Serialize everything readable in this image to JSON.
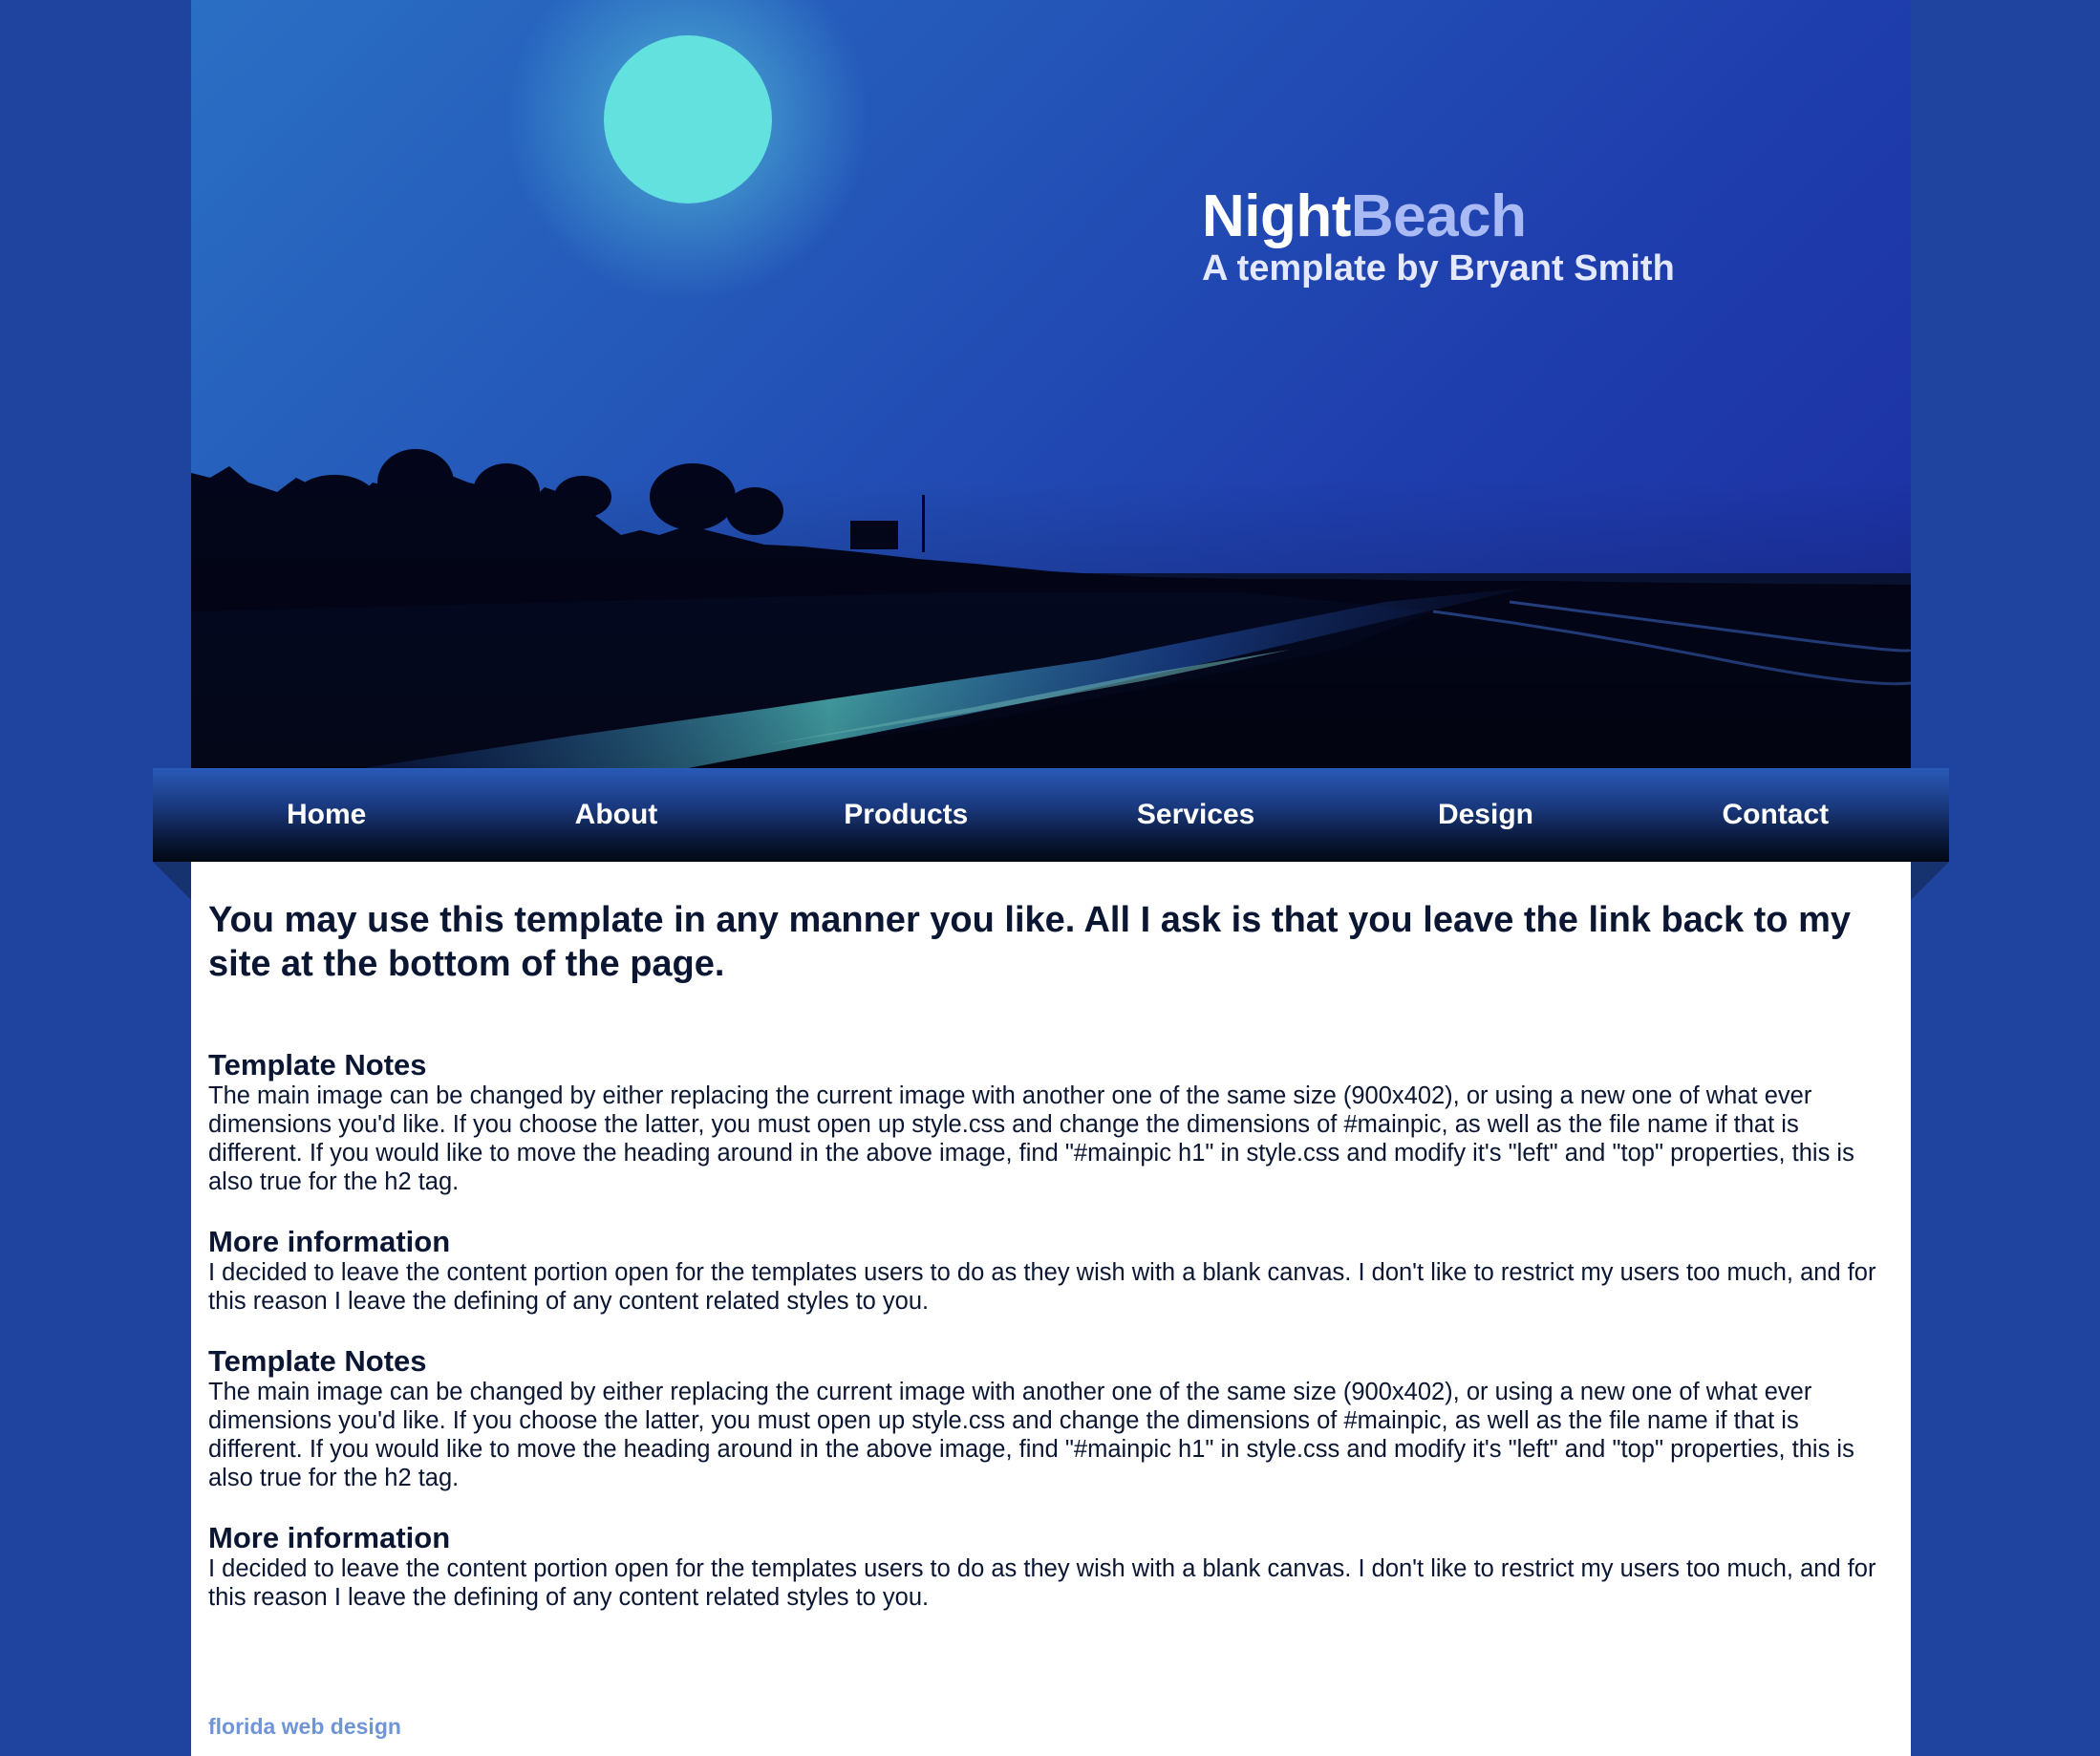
{
  "header": {
    "title_part1": "Night",
    "title_part2": "Beach",
    "subtitle": "A template by Bryant Smith"
  },
  "nav": {
    "items": [
      {
        "label": "Home"
      },
      {
        "label": "About"
      },
      {
        "label": "Products"
      },
      {
        "label": "Services"
      },
      {
        "label": "Design"
      },
      {
        "label": "Contact"
      }
    ]
  },
  "content": {
    "intro": "You may use this template in any manner you like. All I ask is that you leave the link back to my site at the bottom of the page.",
    "sections": [
      {
        "heading": "Template Notes",
        "body": "The main image can be changed by either replacing the current image with another one of the same size (900x402), or using a new one of what ever dimensions you'd like. If you choose the latter, you must open up style.css and change the dimensions of #mainpic, as well as the file name if that is different. If you would like to move the heading around in the above image, find \"#mainpic h1\" in style.css and modify it's \"left\" and \"top\" properties, this is also true for the h2 tag."
      },
      {
        "heading": "More information",
        "body": "I decided to leave the content portion open for the templates users to do as they wish with a blank canvas. I don't like to restrict my users too much, and for this reason I leave the defining of any content related styles to you."
      },
      {
        "heading": "Template Notes",
        "body": "The main image can be changed by either replacing the current image with another one of the same size (900x402), or using a new one of what ever dimensions you'd like. If you choose the latter, you must open up style.css and change the dimensions of #mainpic, as well as the file name if that is different. If you would like to move the heading around in the above image, find \"#mainpic h1\" in style.css and modify it's \"left\" and \"top\" properties, this is also true for the h2 tag."
      },
      {
        "heading": "More information",
        "body": "I decided to leave the content portion open for the templates users to do as they wish with a blank canvas. I don't like to restrict my users too much, and for this reason I leave the defining of any content related styles to you."
      }
    ]
  },
  "footer": {
    "link_text": "florida web design"
  },
  "colors": {
    "page_background": "#1f44a0",
    "title_accent": "#a9baf5",
    "text_dark": "#0a1632",
    "footer_link": "#6f95d8"
  }
}
